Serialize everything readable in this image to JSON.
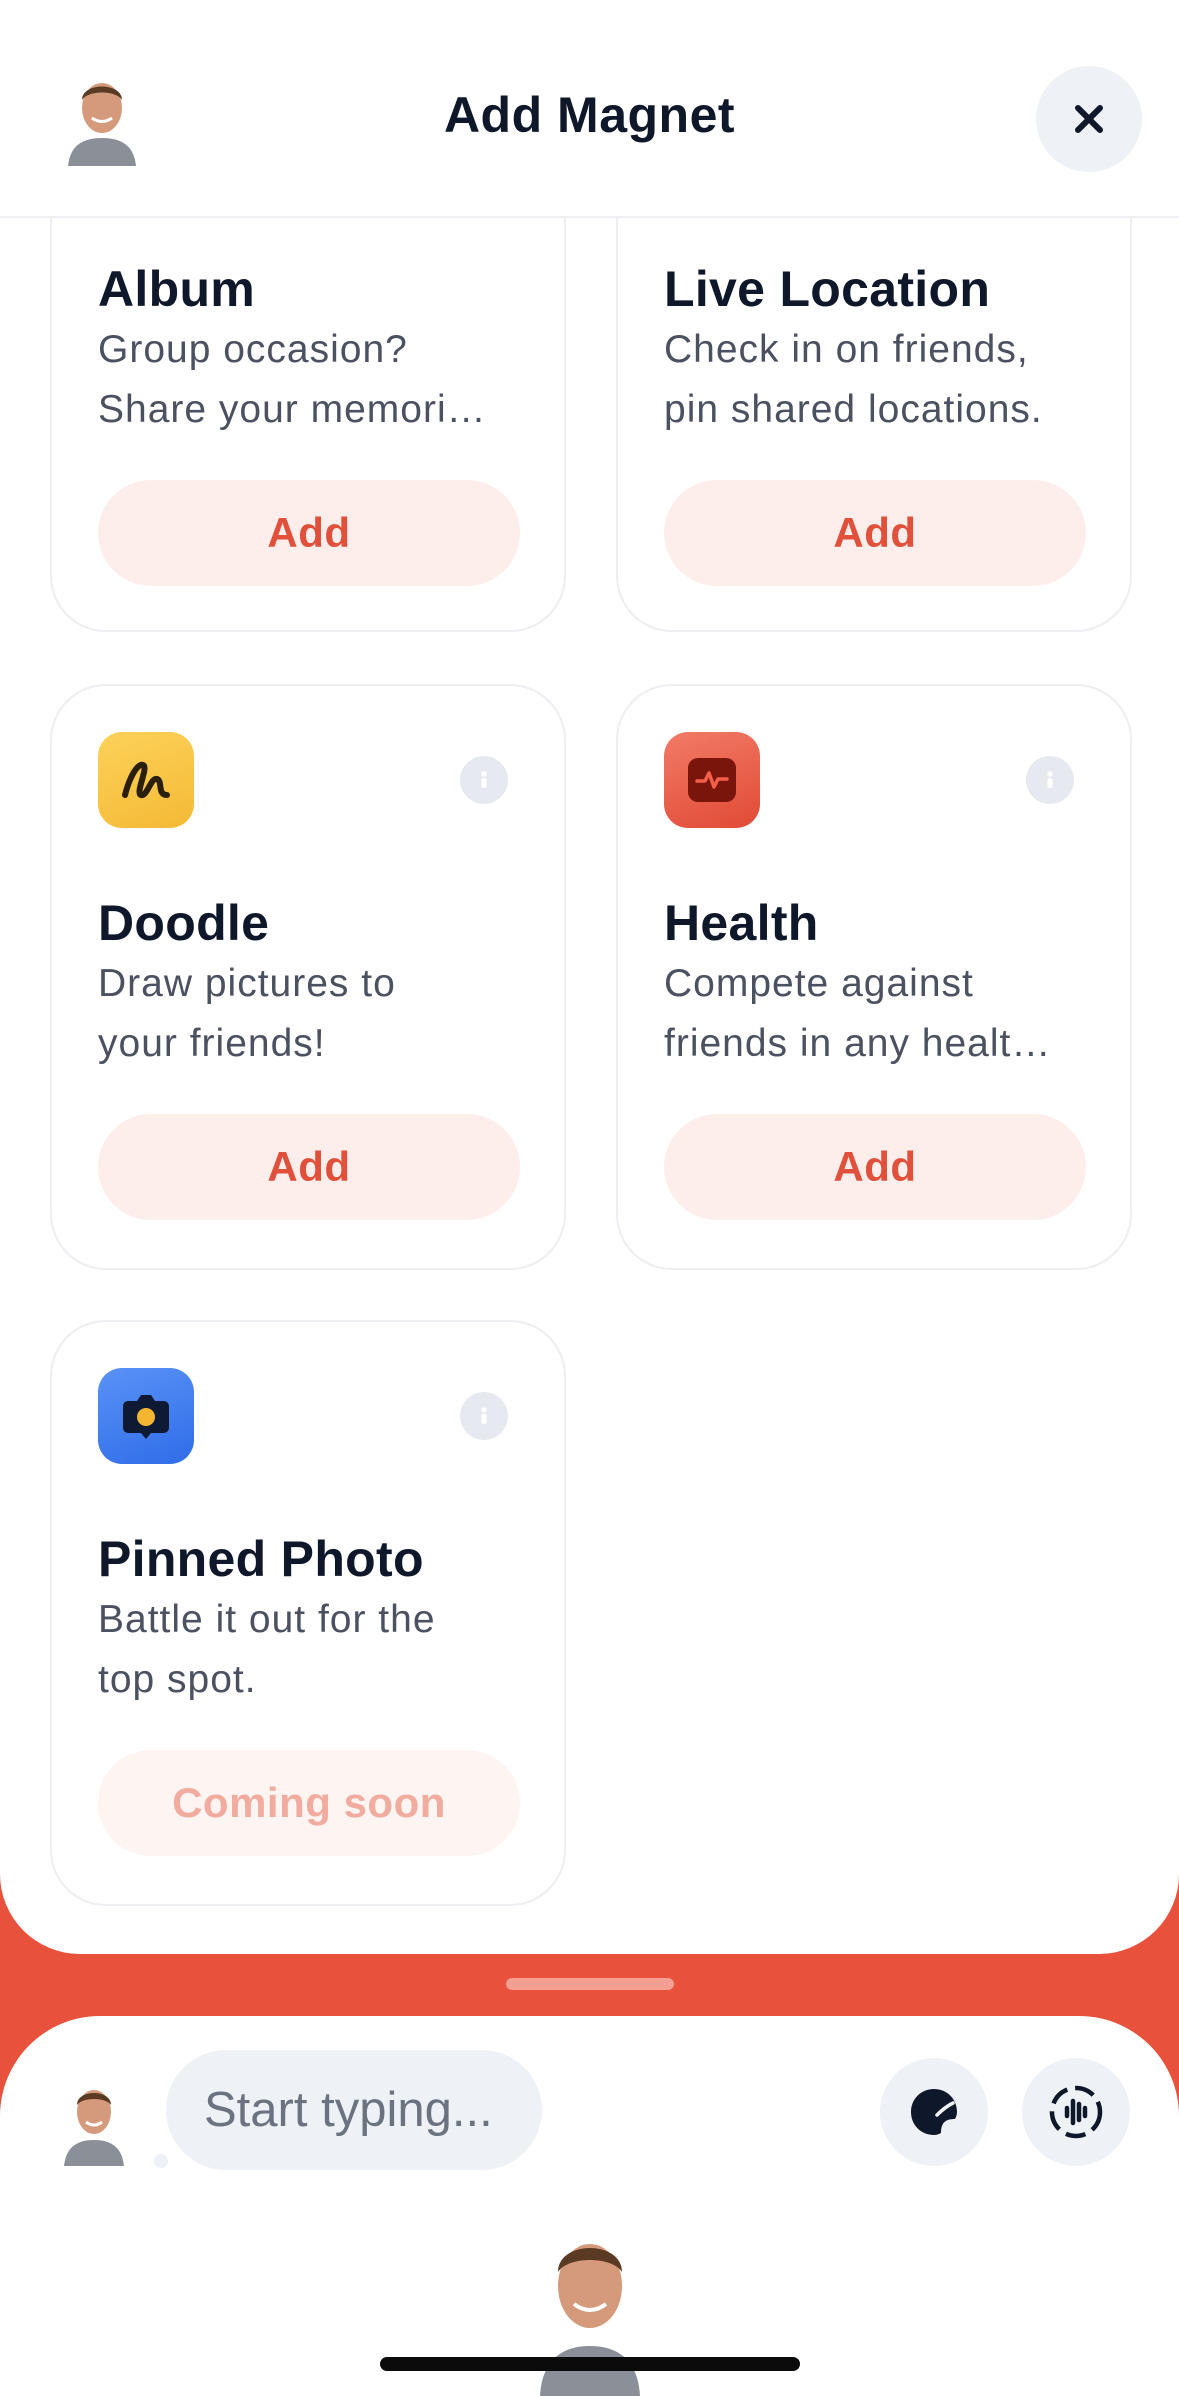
{
  "header": {
    "title": "Add Magnet",
    "avatar_icon": "user-avatar-icon",
    "close_icon": "close-icon"
  },
  "cards": [
    {
      "name": "album",
      "title": "Album",
      "desc": [
        "Group occasion?",
        "Share your memori…"
      ],
      "button": "Add",
      "state": "add"
    },
    {
      "name": "live-location",
      "title": "Live Location",
      "desc": [
        "Check in on friends,",
        "pin shared locations."
      ],
      "button": "Add",
      "state": "add"
    },
    {
      "name": "doodle",
      "title": "Doodle",
      "desc": [
        "Draw pictures to",
        "your friends!"
      ],
      "button": "Add",
      "state": "add",
      "icon": "doodle-icon",
      "icon_color": "#f8c540"
    },
    {
      "name": "health",
      "title": "Health",
      "desc": [
        "Compete against",
        "friends in any healt…"
      ],
      "button": "Add",
      "state": "add",
      "icon": "heartbeat-icon",
      "icon_color": "#e8513b"
    },
    {
      "name": "pinned-photo",
      "title": "Pinned Photo",
      "desc": [
        "Battle it out for the",
        "top spot."
      ],
      "button": "Coming soon",
      "state": "disabled",
      "icon": "camera-icon",
      "icon_color": "#3b7cf0"
    }
  ],
  "composer": {
    "placeholder": "Start typing...",
    "sticker_icon": "sticker-icon",
    "voice_icon": "voice-waveform-icon"
  },
  "colors": {
    "accent": "#e8513b",
    "button_bg": "#fdeeeb",
    "button_text": "#e0503a",
    "title": "#0f172a"
  }
}
